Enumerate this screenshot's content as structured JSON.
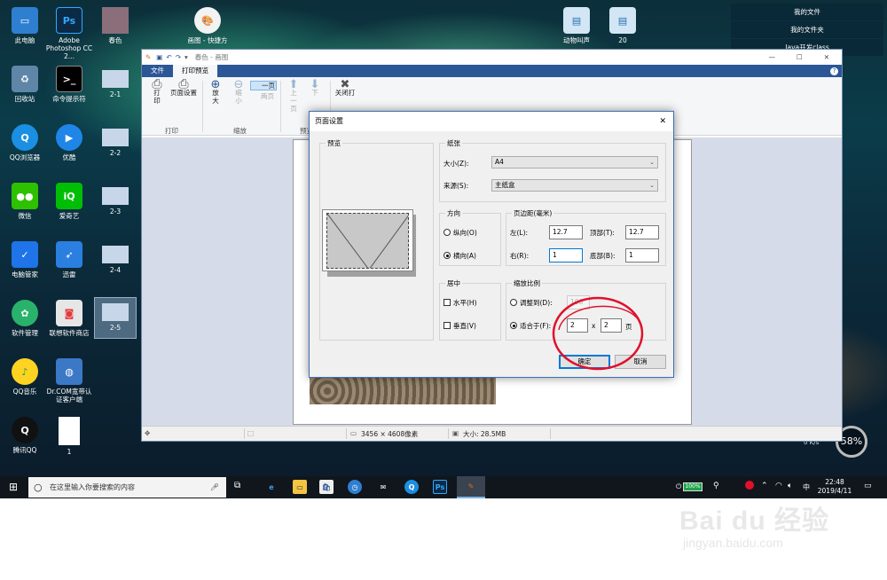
{
  "desktop": {
    "icons": [
      {
        "label": "此电脑"
      },
      {
        "label": "Adobe Photoshop CC 2..."
      },
      {
        "label": "春色"
      },
      {
        "label": "画图 - 快捷方"
      },
      {
        "label": "动物叫声"
      },
      {
        "label": "20"
      },
      {
        "label": "回收站"
      },
      {
        "label": "命令提示符"
      },
      {
        "label": "2-1"
      },
      {
        "label": "QQ浏览器"
      },
      {
        "label": "优酷"
      },
      {
        "label": "2-2"
      },
      {
        "label": "微信"
      },
      {
        "label": "爱奇艺"
      },
      {
        "label": "2-3"
      },
      {
        "label": "电脑管家"
      },
      {
        "label": "迅雷"
      },
      {
        "label": "2-4"
      },
      {
        "label": "软件管理"
      },
      {
        "label": "联想软件商店"
      },
      {
        "label": "2-5"
      },
      {
        "label": "QQ音乐"
      },
      {
        "label": "Dr.COM宽带认证客户端"
      },
      {
        "label": "腾讯QQ"
      },
      {
        "label": "1"
      }
    ],
    "right_panel": [
      "我的文件",
      "我的文件夹",
      "Java开发class"
    ],
    "gauge": "58%",
    "speed": "0 K/s"
  },
  "paint": {
    "title": "春色 - 画图",
    "tabs": [
      "文件",
      "打印预览"
    ],
    "ribbon": {
      "print": "打印",
      "page_setup": "页面设置",
      "print_group": "打印",
      "zoom_in": "放大",
      "zoom_out": "缩小",
      "one_page": "一页",
      "two_pages": "两页",
      "zoom_group": "缩放",
      "prev_page": "上一页",
      "next_page": "下",
      "preview_group": "预览",
      "close": "关闭打"
    },
    "status": {
      "dimensions": "3456 × 4608像素",
      "size": "大小: 28.5MB"
    }
  },
  "dialog": {
    "title": "页面设置",
    "preview_label": "预览",
    "paper_label": "纸张",
    "size_label": "大小(Z):",
    "size_value": "A4",
    "source_label": "来源(S):",
    "source_value": "主纸盒",
    "orientation_label": "方向",
    "portrait": "纵向(O)",
    "landscape": "横向(A)",
    "margins_label": "页边距(毫米)",
    "left_label": "左(L):",
    "left_value": "12.7",
    "top_label": "顶部(T):",
    "top_value": "12.7",
    "right_label": "右(R):",
    "right_value": "1",
    "bottom_label": "底部(B):",
    "bottom_value": "1",
    "center_label": "居中",
    "horizontal": "水平(H)",
    "vertical": "垂直(V)",
    "scale_label": "缩放比例",
    "adjust_to": "调整到(D):",
    "adjust_value": "100",
    "fit_to": "适合于(F):",
    "fit_w": "2",
    "fit_x": "x",
    "fit_h": "2",
    "pages": "页",
    "ok": "确定",
    "cancel": "取消"
  },
  "taskbar": {
    "search_placeholder": "在这里输入你要搜索的内容",
    "battery": "100%",
    "ime": "中",
    "time": "22:48",
    "date": "2019/4/11"
  },
  "watermark": {
    "brand": "Bai du 经验",
    "url": "jingyan.baidu.com"
  },
  "colors": {
    "annotation_circle": "#e0102a",
    "accent": "#0078d7"
  }
}
